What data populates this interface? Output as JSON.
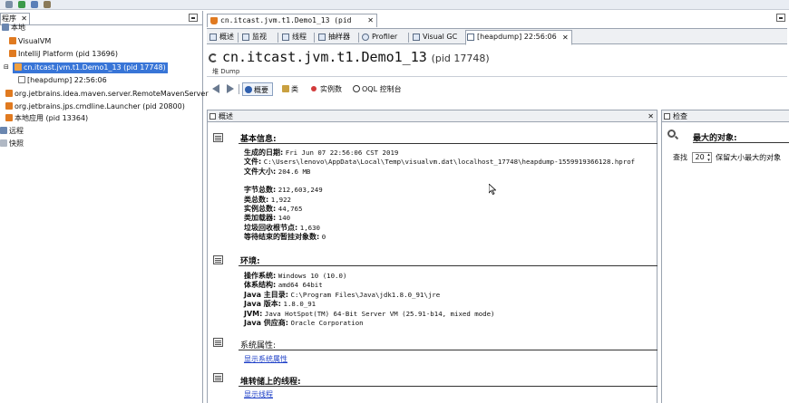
{
  "left_panel": {
    "tab_label": "程序",
    "tree": [
      {
        "label": "本地"
      },
      {
        "label": "VisualVM"
      },
      {
        "label": "IntelliJ Platform (pid 13696)"
      },
      {
        "label": "cn.itcast.jvm.t1.Demo1_13 (pid 17748)",
        "selected": true
      },
      {
        "label": "[heapdump] 22:56:06"
      },
      {
        "label": "org.jetbrains.idea.maven.server.RemoteMavenServer"
      },
      {
        "label": "org.jetbrains.jps.cmdline.Launcher (pid 20800)"
      },
      {
        "label": "本地应用 (pid 13364)"
      },
      {
        "label": "远程"
      },
      {
        "label": "快照"
      }
    ]
  },
  "main_tab": {
    "label": "cn.itcast.jvm.t1.Demo1_13 (pid 17748)"
  },
  "subtabs": [
    {
      "label": "概述"
    },
    {
      "label": "监视"
    },
    {
      "label": "线程"
    },
    {
      "label": "抽样器"
    },
    {
      "label": "Profiler"
    },
    {
      "label": "Visual GC"
    },
    {
      "label": "[heapdump] 22:56:06"
    }
  ],
  "title": {
    "main": "cn.itcast.jvm.t1.Demo1_13",
    "pid": "(pid 17748)"
  },
  "subtitle": "堆 Dump",
  "nav": {
    "summary": "概要",
    "classes": "类",
    "instances": "实例数",
    "oql": "OQL 控制台"
  },
  "overview": {
    "header": "概述",
    "basic": {
      "title": "基本信息:",
      "rows": [
        {
          "k": "生成的日期:",
          "v": "Fri Jun 07 22:56:06 CST 2019"
        },
        {
          "k": "文件:",
          "v": "C:\\Users\\lenovo\\AppData\\Local\\Temp\\visualvm.dat\\localhost_17748\\heapdump-1559919366128.hprof"
        },
        {
          "k": "文件大小:",
          "v": "204.6 MB"
        },
        {
          "k": "字节总数:",
          "v": "212,603,249"
        },
        {
          "k": "类总数:",
          "v": "1,922"
        },
        {
          "k": "实例总数:",
          "v": "44,765"
        },
        {
          "k": "类加载器:",
          "v": "140"
        },
        {
          "k": "垃圾回收根节点:",
          "v": "1,630"
        },
        {
          "k": "等待结束的暂挂对象数:",
          "v": "0"
        }
      ]
    },
    "env": {
      "title": "环境:",
      "rows": [
        {
          "k": "操作系统:",
          "v": "Windows 10 (10.0)"
        },
        {
          "k": "体系结构:",
          "v": "amd64 64bit"
        },
        {
          "k": "Java 主目录:",
          "v": "C:\\Program Files\\Java\\jdk1.8.0_91\\jre"
        },
        {
          "k": "Java 版本:",
          "v": "1.8.0_91"
        },
        {
          "k": "JVM:",
          "v": "Java HotSpot(TM) 64-Bit Server VM (25.91-b14, mixed mode)"
        },
        {
          "k": "Java 供应商:",
          "v": "Oracle Corporation"
        }
      ]
    },
    "sysprops": {
      "title": "系统属性:",
      "link": "显示系统属性"
    },
    "threads": {
      "title": "堆转储上的线程:",
      "link": "显示线程"
    }
  },
  "inspect": {
    "header": "检查",
    "title": "最大的对象:",
    "find_label": "查找",
    "find_value": "20",
    "find_suffix": "保留大小最大的对象"
  },
  "colors": {
    "selection": "#3875d7",
    "link": "#1d3fc7",
    "border": "#9aa3b0"
  }
}
